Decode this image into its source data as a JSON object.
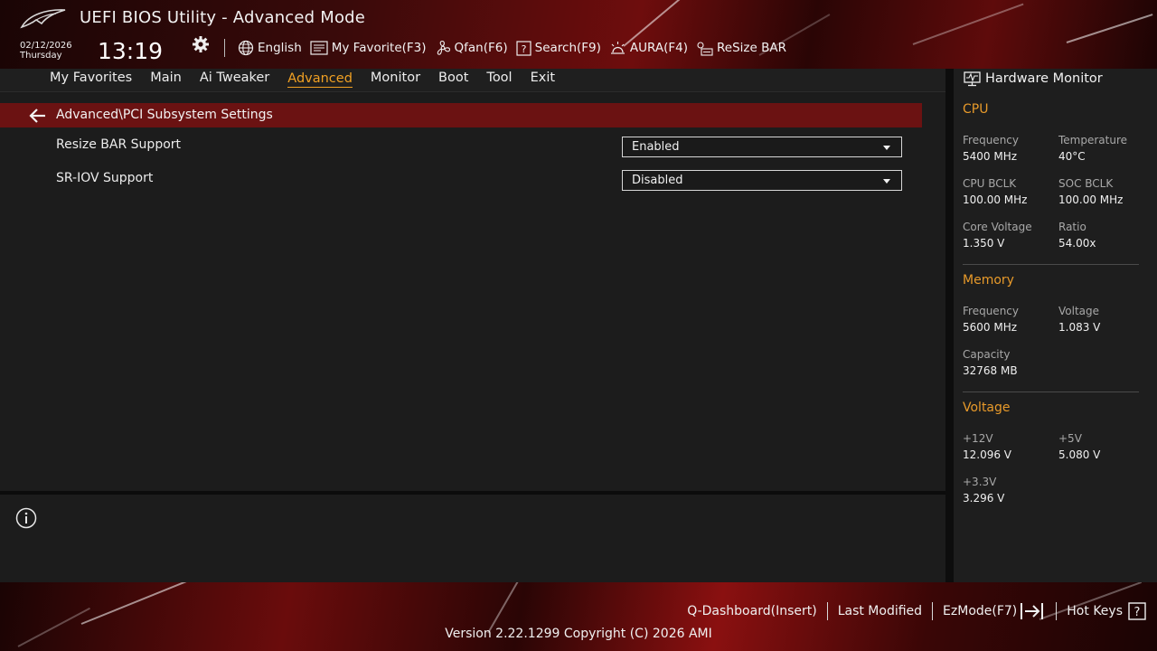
{
  "header": {
    "app_title": "UEFI BIOS Utility - Advanced Mode",
    "date": "02/12/2026",
    "weekday": "Thursday",
    "time": "13:19",
    "toolbar": [
      {
        "label": "English",
        "icon": "globe-icon"
      },
      {
        "label": "My Favorite(F3)",
        "icon": "favorite-list-icon"
      },
      {
        "label": "Qfan(F6)",
        "icon": "fan-icon"
      },
      {
        "label": "Search(F9)",
        "icon": "search-question-icon"
      },
      {
        "label": "AURA(F4)",
        "icon": "aura-light-icon"
      },
      {
        "label": "ReSize BAR",
        "icon": "resize-bar-icon"
      }
    ]
  },
  "menu": {
    "items": [
      "My Favorites",
      "Main",
      "Ai Tweaker",
      "Advanced",
      "Monitor",
      "Boot",
      "Tool",
      "Exit"
    ],
    "active": "Advanced"
  },
  "page": {
    "breadcrumb": "Advanced\\PCI Subsystem Settings",
    "settings": [
      {
        "label": "Resize BAR Support",
        "value": "Enabled"
      },
      {
        "label": "SR-IOV Support",
        "value": "Disabled"
      }
    ]
  },
  "hardware_monitor": {
    "title": "Hardware Monitor",
    "cpu": {
      "heading": "CPU",
      "frequency_label": "Frequency",
      "frequency": "5400 MHz",
      "temperature_label": "Temperature",
      "temperature": "40°C",
      "bclk_label": "CPU BCLK",
      "bclk": "100.00 MHz",
      "soc_bclk_label": "SOC BCLK",
      "soc_bclk": "100.00 MHz",
      "core_voltage_label": "Core Voltage",
      "core_voltage": "1.350 V",
      "ratio_label": "Ratio",
      "ratio": "54.00x"
    },
    "memory": {
      "heading": "Memory",
      "frequency_label": "Frequency",
      "frequency": "5600 MHz",
      "voltage_label": "Voltage",
      "voltage": "1.083 V",
      "capacity_label": "Capacity",
      "capacity": "32768 MB"
    },
    "voltage": {
      "heading": "Voltage",
      "v12_label": "+12V",
      "v12": "12.096 V",
      "v5_label": "+5V",
      "v5": "5.080 V",
      "v33_label": "+3.3V",
      "v33": "3.296 V"
    }
  },
  "footer": {
    "qdashboard": "Q-Dashboard(Insert)",
    "last_modified": "Last Modified",
    "ezmode": "EzMode(F7)",
    "hotkeys": "Hot Keys",
    "version": "Version 2.22.1299 Copyright (C) 2026 AMI"
  },
  "colors": {
    "accent": "#f0a023",
    "breadcrumb_bar": "#6b1212",
    "section_heading": "#e89a2a"
  }
}
